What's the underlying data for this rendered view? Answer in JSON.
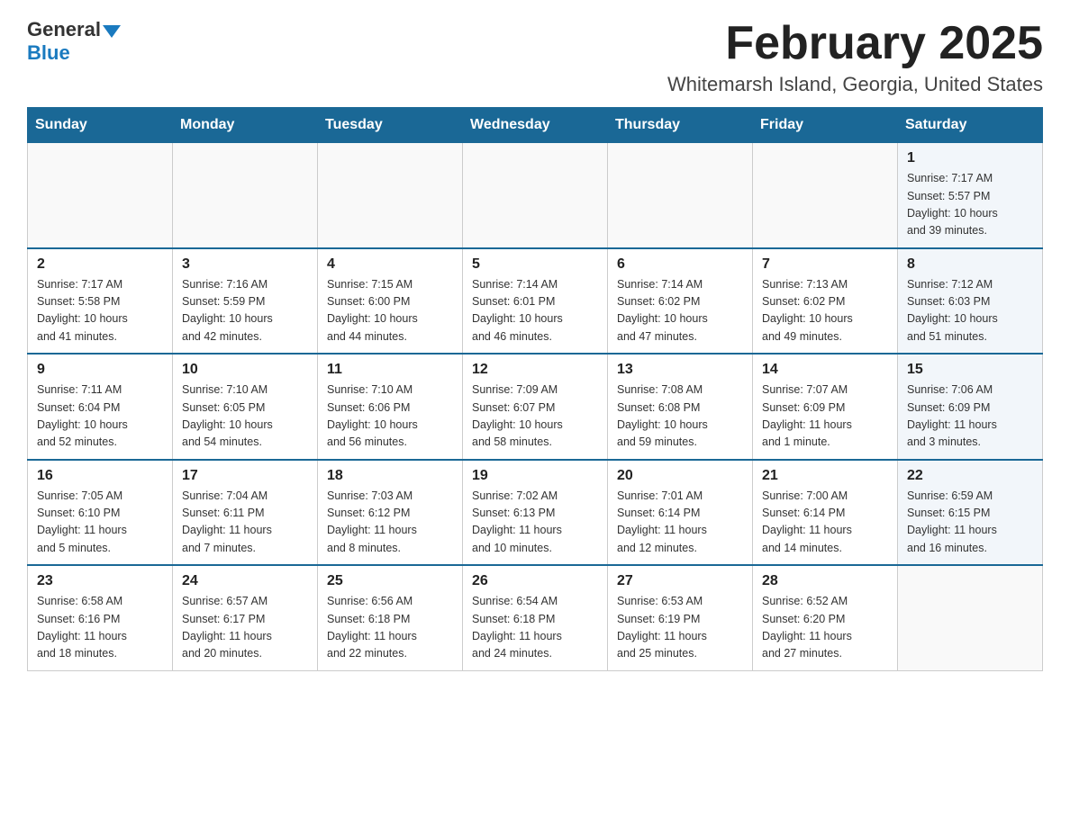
{
  "logo": {
    "general": "General",
    "blue": "Blue"
  },
  "header": {
    "month": "February 2025",
    "location": "Whitemarsh Island, Georgia, United States"
  },
  "weekdays": [
    "Sunday",
    "Monday",
    "Tuesday",
    "Wednesday",
    "Thursday",
    "Friday",
    "Saturday"
  ],
  "weeks": [
    [
      {
        "day": "",
        "info": ""
      },
      {
        "day": "",
        "info": ""
      },
      {
        "day": "",
        "info": ""
      },
      {
        "day": "",
        "info": ""
      },
      {
        "day": "",
        "info": ""
      },
      {
        "day": "",
        "info": ""
      },
      {
        "day": "1",
        "info": "Sunrise: 7:17 AM\nSunset: 5:57 PM\nDaylight: 10 hours\nand 39 minutes."
      }
    ],
    [
      {
        "day": "2",
        "info": "Sunrise: 7:17 AM\nSunset: 5:58 PM\nDaylight: 10 hours\nand 41 minutes."
      },
      {
        "day": "3",
        "info": "Sunrise: 7:16 AM\nSunset: 5:59 PM\nDaylight: 10 hours\nand 42 minutes."
      },
      {
        "day": "4",
        "info": "Sunrise: 7:15 AM\nSunset: 6:00 PM\nDaylight: 10 hours\nand 44 minutes."
      },
      {
        "day": "5",
        "info": "Sunrise: 7:14 AM\nSunset: 6:01 PM\nDaylight: 10 hours\nand 46 minutes."
      },
      {
        "day": "6",
        "info": "Sunrise: 7:14 AM\nSunset: 6:02 PM\nDaylight: 10 hours\nand 47 minutes."
      },
      {
        "day": "7",
        "info": "Sunrise: 7:13 AM\nSunset: 6:02 PM\nDaylight: 10 hours\nand 49 minutes."
      },
      {
        "day": "8",
        "info": "Sunrise: 7:12 AM\nSunset: 6:03 PM\nDaylight: 10 hours\nand 51 minutes."
      }
    ],
    [
      {
        "day": "9",
        "info": "Sunrise: 7:11 AM\nSunset: 6:04 PM\nDaylight: 10 hours\nand 52 minutes."
      },
      {
        "day": "10",
        "info": "Sunrise: 7:10 AM\nSunset: 6:05 PM\nDaylight: 10 hours\nand 54 minutes."
      },
      {
        "day": "11",
        "info": "Sunrise: 7:10 AM\nSunset: 6:06 PM\nDaylight: 10 hours\nand 56 minutes."
      },
      {
        "day": "12",
        "info": "Sunrise: 7:09 AM\nSunset: 6:07 PM\nDaylight: 10 hours\nand 58 minutes."
      },
      {
        "day": "13",
        "info": "Sunrise: 7:08 AM\nSunset: 6:08 PM\nDaylight: 10 hours\nand 59 minutes."
      },
      {
        "day": "14",
        "info": "Sunrise: 7:07 AM\nSunset: 6:09 PM\nDaylight: 11 hours\nand 1 minute."
      },
      {
        "day": "15",
        "info": "Sunrise: 7:06 AM\nSunset: 6:09 PM\nDaylight: 11 hours\nand 3 minutes."
      }
    ],
    [
      {
        "day": "16",
        "info": "Sunrise: 7:05 AM\nSunset: 6:10 PM\nDaylight: 11 hours\nand 5 minutes."
      },
      {
        "day": "17",
        "info": "Sunrise: 7:04 AM\nSunset: 6:11 PM\nDaylight: 11 hours\nand 7 minutes."
      },
      {
        "day": "18",
        "info": "Sunrise: 7:03 AM\nSunset: 6:12 PM\nDaylight: 11 hours\nand 8 minutes."
      },
      {
        "day": "19",
        "info": "Sunrise: 7:02 AM\nSunset: 6:13 PM\nDaylight: 11 hours\nand 10 minutes."
      },
      {
        "day": "20",
        "info": "Sunrise: 7:01 AM\nSunset: 6:14 PM\nDaylight: 11 hours\nand 12 minutes."
      },
      {
        "day": "21",
        "info": "Sunrise: 7:00 AM\nSunset: 6:14 PM\nDaylight: 11 hours\nand 14 minutes."
      },
      {
        "day": "22",
        "info": "Sunrise: 6:59 AM\nSunset: 6:15 PM\nDaylight: 11 hours\nand 16 minutes."
      }
    ],
    [
      {
        "day": "23",
        "info": "Sunrise: 6:58 AM\nSunset: 6:16 PM\nDaylight: 11 hours\nand 18 minutes."
      },
      {
        "day": "24",
        "info": "Sunrise: 6:57 AM\nSunset: 6:17 PM\nDaylight: 11 hours\nand 20 minutes."
      },
      {
        "day": "25",
        "info": "Sunrise: 6:56 AM\nSunset: 6:18 PM\nDaylight: 11 hours\nand 22 minutes."
      },
      {
        "day": "26",
        "info": "Sunrise: 6:54 AM\nSunset: 6:18 PM\nDaylight: 11 hours\nand 24 minutes."
      },
      {
        "day": "27",
        "info": "Sunrise: 6:53 AM\nSunset: 6:19 PM\nDaylight: 11 hours\nand 25 minutes."
      },
      {
        "day": "28",
        "info": "Sunrise: 6:52 AM\nSunset: 6:20 PM\nDaylight: 11 hours\nand 27 minutes."
      },
      {
        "day": "",
        "info": ""
      }
    ]
  ]
}
